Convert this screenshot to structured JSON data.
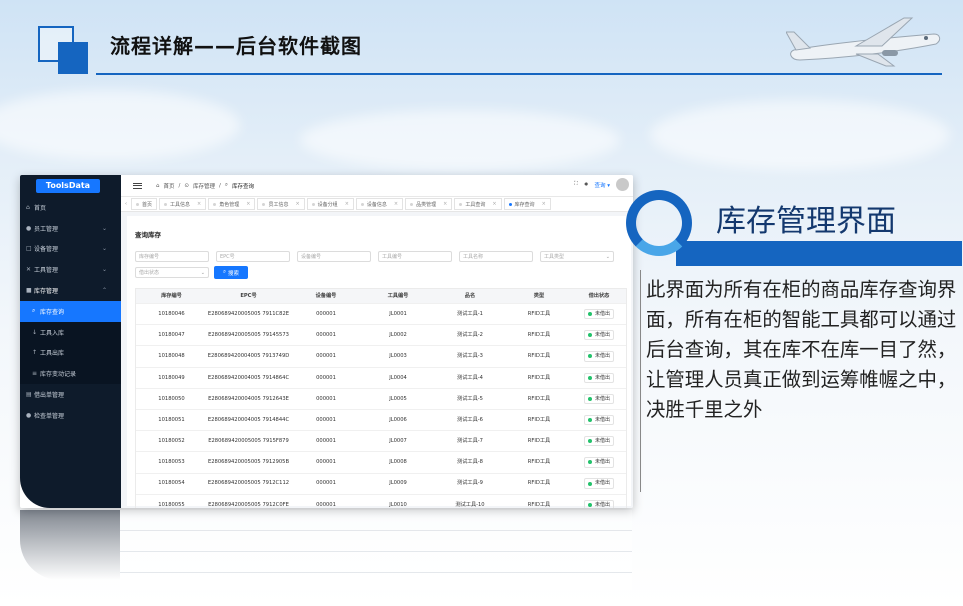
{
  "slide": {
    "title": "流程详解——后台软件截图",
    "section_title": "库存管理界面",
    "description": "此界面为所有在柜的商品库存查询界面，所有在柜的智能工具都可以通过后台查询，其在库不在库一目了然，让管理人员真正做到运筹帷幄之中，决胜千里之外",
    "accent_color": "#1565c0"
  },
  "app": {
    "brand": "ToolsData",
    "sidebar": [
      {
        "label": "首页",
        "icon": "home-icon",
        "ic": "⌂"
      },
      {
        "label": "员工管理",
        "icon": "users-icon",
        "ic": "●",
        "caret": "⌄"
      },
      {
        "label": "设备管理",
        "icon": "device-icon",
        "ic": "□",
        "caret": "⌄"
      },
      {
        "label": "工具管理",
        "icon": "tools-icon",
        "ic": "✕",
        "caret": "⌄"
      },
      {
        "label": "库存管理",
        "icon": "inventory-icon",
        "ic": "■",
        "caret": "⌃",
        "open": true
      },
      {
        "label": "库存查询",
        "icon": "search-icon",
        "ic": "⌕",
        "sub": true,
        "active": true
      },
      {
        "label": "工具入库",
        "icon": "arrow-down-icon",
        "ic": "↓",
        "sub": true
      },
      {
        "label": "工具出库",
        "icon": "arrow-up-icon",
        "ic": "↑",
        "sub": true
      },
      {
        "label": "库存变动记录",
        "icon": "list-icon",
        "ic": "≡",
        "sub": true
      },
      {
        "label": "借出单管理",
        "icon": "doc-icon",
        "ic": "▤"
      },
      {
        "label": "检查单管理",
        "icon": "check-icon",
        "ic": "●"
      }
    ],
    "breadcrumb": [
      "首页",
      "库存管理",
      "库存查询"
    ],
    "user": "查询 ▾",
    "tabs": [
      "首页",
      "工具信息",
      "角色管理",
      "员工信息",
      "设备分组",
      "设备信息",
      "品类管理",
      "工具查询",
      "库存查询"
    ],
    "panel_title": "查询库存",
    "filters": [
      "库存编号",
      "EPC号",
      "设备编号",
      "工具编号",
      "工具名称",
      "工具类型"
    ],
    "filter2": "借出状态",
    "search_button": "搜索",
    "columns": [
      "库存编号",
      "EPC号",
      "设备编号",
      "工具编号",
      "品名",
      "类型",
      "借出状态"
    ],
    "rows": [
      [
        "10180046",
        "E280689420005005 7911C82E",
        "000001",
        "JL0001",
        "测试工具-1",
        "RFID工具",
        "未借出"
      ],
      [
        "10180047",
        "E280689420005005 79145573",
        "000001",
        "JL0002",
        "测试工具-2",
        "RFID工具",
        "未借出"
      ],
      [
        "10180048",
        "E280689420004005 7913749D",
        "000001",
        "JL0003",
        "测试工具-3",
        "RFID工具",
        "未借出"
      ],
      [
        "10180049",
        "E280689420004005 7914864C",
        "000001",
        "JL0004",
        "测试工具-4",
        "RFID工具",
        "未借出"
      ],
      [
        "10180050",
        "E280689420004005 7912643E",
        "000001",
        "JL0005",
        "测试工具-5",
        "RFID工具",
        "未借出"
      ],
      [
        "10180051",
        "E280689420004005 7914844C",
        "000001",
        "JL0006",
        "测试工具-6",
        "RFID工具",
        "未借出"
      ],
      [
        "10180052",
        "E280689420005005 7915F879",
        "000001",
        "JL0007",
        "测试工具-7",
        "RFID工具",
        "未借出"
      ],
      [
        "10180053",
        "E280689420005005 7912905B",
        "000001",
        "JL0008",
        "测试工具-8",
        "RFID工具",
        "未借出"
      ],
      [
        "10180054",
        "E280689420005005 7912C112",
        "000001",
        "JL0009",
        "测试工具-9",
        "RFID工具",
        "未借出"
      ],
      [
        "10180055",
        "E280689420005005 7912C0FE",
        "000001",
        "JL0010",
        "测试工具-10",
        "RFID工具",
        "未借出"
      ]
    ]
  }
}
